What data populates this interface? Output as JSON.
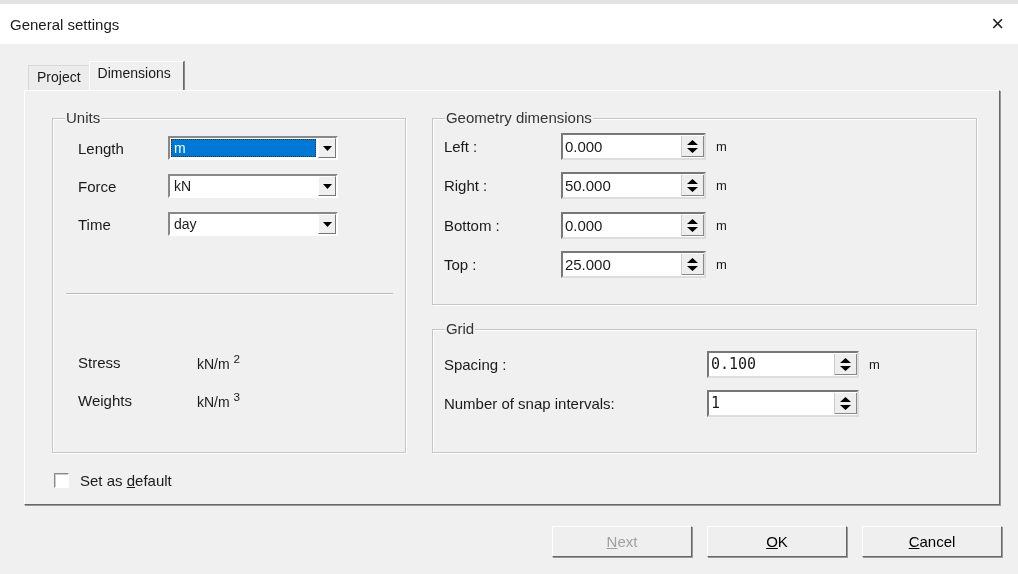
{
  "window": {
    "title": "General settings",
    "close": "×"
  },
  "tabs": [
    {
      "label": "Project",
      "selected": false
    },
    {
      "label": "Dimensions",
      "selected": true
    }
  ],
  "units": {
    "title": "Units",
    "fields": [
      {
        "label": "Length",
        "value": "m",
        "selected": true
      },
      {
        "label": "Force",
        "value": "kN",
        "selected": false
      },
      {
        "label": "Time",
        "value": "day",
        "selected": false
      }
    ],
    "derived": [
      {
        "label": "Stress",
        "value": "kN/m $^{2}$"
      },
      {
        "label": "Weights",
        "value": "kN/m $^{3}$"
      }
    ]
  },
  "geometry": {
    "title": "Geometry dimensions",
    "fields": [
      {
        "label": "Left :",
        "value": "0.000",
        "unit": "m"
      },
      {
        "label": "Right :",
        "value": "50.000",
        "unit": "m"
      },
      {
        "label": "Bottom :",
        "value": "0.000",
        "unit": "m"
      },
      {
        "label": "Top :",
        "value": "25.000",
        "unit": "m"
      }
    ]
  },
  "grid": {
    "title": "Grid",
    "fields": [
      {
        "label": "Spacing :",
        "value": "0.100",
        "unit": "m"
      },
      {
        "label": "Number of snap intervals:",
        "value": "1"
      }
    ]
  },
  "set_default": {
    "label_before": "Set as ",
    "label_key": "d",
    "label_after": "efault",
    "checked": false
  },
  "buttons": [
    {
      "label_key": "N",
      "label_after": "ext",
      "disabled": true
    },
    {
      "label_key": "O",
      "label_after": "K",
      "disabled": false
    },
    {
      "label_key": "C",
      "label_after": "ancel",
      "disabled": false
    }
  ]
}
